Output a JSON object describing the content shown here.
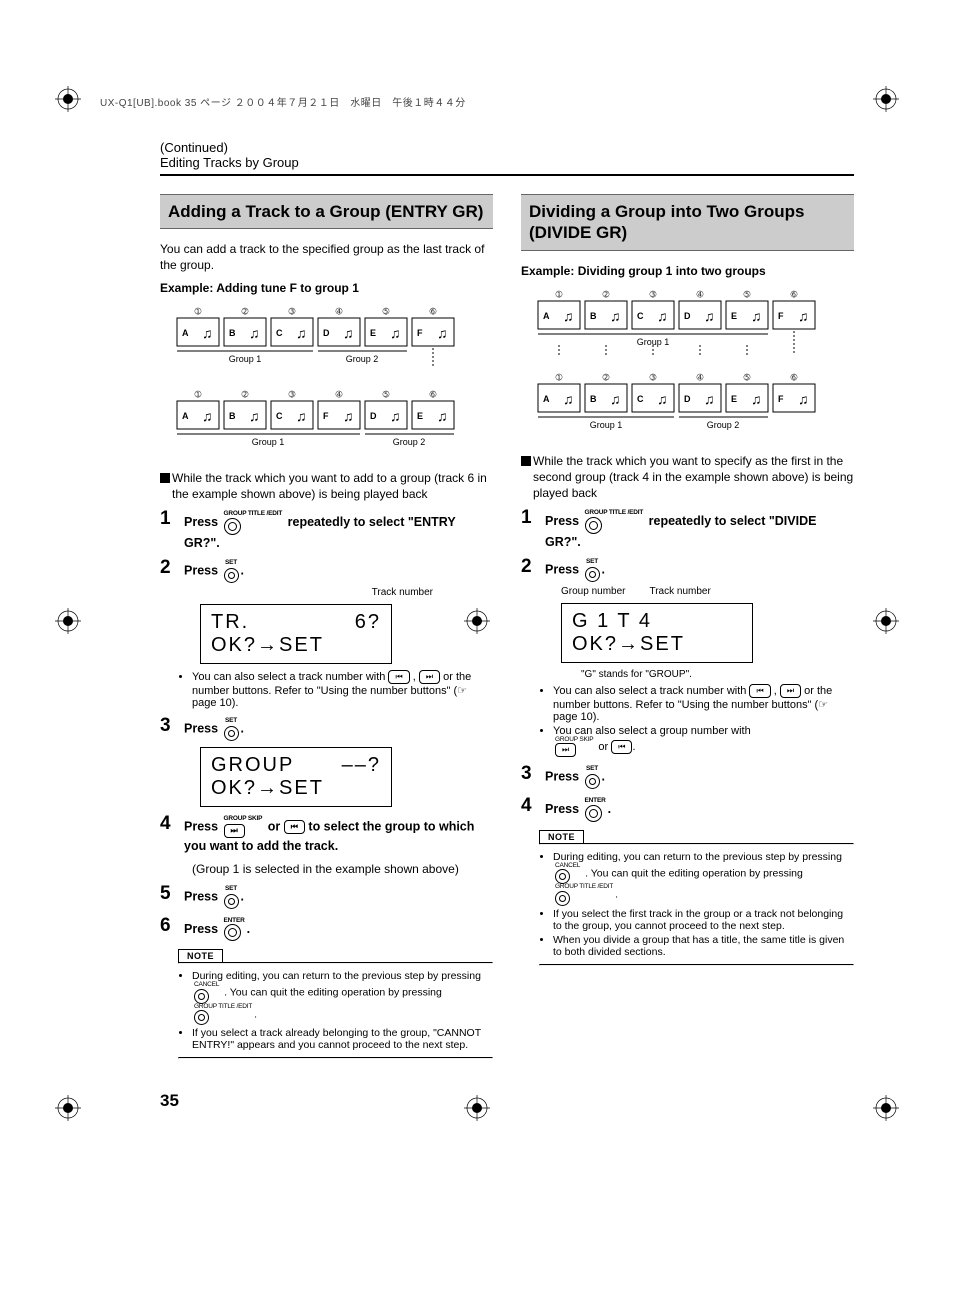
{
  "header_meta": "UX-Q1[UB].book  35 ページ  ２００４年７月２１日　水曜日　午後１時４４分",
  "continued": "(Continued)",
  "section_title": "Editing Tracks by Group",
  "page_number": "35",
  "icon_labels": {
    "group_title_edit": "GROUP TITLE /EDIT",
    "set": "SET",
    "enter": "ENTER",
    "group_skip": "GROUP SKIP",
    "cancel": "CANCEL"
  },
  "left": {
    "heading": "Adding a Track to a Group (ENTRY GR)",
    "intro": "You can add a track to the specified group as the last track of the group.",
    "example_label": "Example: Adding tune F to group 1",
    "diagram": {
      "before": {
        "numbers": [
          "➀",
          "➁",
          "➂",
          "➃",
          "➄",
          "➅"
        ],
        "letters": [
          "A",
          "B",
          "C",
          "D",
          "E",
          "F"
        ],
        "group1_label": "Group 1",
        "group2_label": "Group 2"
      },
      "after": {
        "numbers": [
          "➀",
          "➁",
          "➂",
          "➃",
          "➄",
          "➅"
        ],
        "letters": [
          "A",
          "B",
          "C",
          "F",
          "D",
          "E"
        ],
        "group1_label": "Group 1",
        "group2_label": "Group 2"
      }
    },
    "precondition": "While the track which you want to add to a group (track 6 in the example shown above) is being played back",
    "step1": "Press",
    "step1_tail": "repeatedly to select \"ENTRY GR?\".",
    "step2": "Press",
    "display1_label": "Track number",
    "display1_line1_left": "TR.",
    "display1_line1_right": "6?",
    "display1_line2": "OK?→SET",
    "bullet1": "You can also select a track number with",
    "bullet1_tail": "or the number buttons. Refer to \"Using the number buttons\" (☞ page 10).",
    "step3": "Press",
    "display2_line1_left": "GROUP",
    "display2_line1_right": "––?",
    "display2_line2": "OK?→SET",
    "step4": "Press",
    "step4_mid": "or",
    "step4_tail": "to select the group to which you want to add the track.",
    "step4_note": "(Group 1 is selected in the example shown above)",
    "step5": "Press",
    "step6": "Press",
    "note_label": "NOTE",
    "notes": [
      "During editing, you can return to the previous step by pressing      . You can quit the editing operation by pressing      .",
      "If you select a track already belonging to the group, \"CANNOT ENTRY!\" appears and you cannot proceed to the next step."
    ]
  },
  "right": {
    "heading": "Dividing a Group into Two Groups (DIVIDE GR)",
    "example_label": "Example: Dividing group 1 into two groups",
    "diagram": {
      "before": {
        "numbers": [
          "➀",
          "➁",
          "➂",
          "➃",
          "➄",
          "➅"
        ],
        "letters": [
          "A",
          "B",
          "C",
          "D",
          "E",
          "F"
        ],
        "group1_label": "Group 1"
      },
      "after": {
        "numbers": [
          "➀",
          "➁",
          "➂",
          "➃",
          "➄",
          "➅"
        ],
        "letters": [
          "A",
          "B",
          "C",
          "D",
          "E",
          "F"
        ],
        "group1_label": "Group 1",
        "group2_label": "Group 2"
      }
    },
    "precondition": "While the track which you want to specify as the first in the second group (track 4 in the example shown above) is being played back",
    "step1": "Press",
    "step1_tail": "repeatedly to select \"DIVIDE GR?\".",
    "step2": "Press",
    "display1_label_left": "Group number",
    "display1_label_right": "Track number",
    "display1_line1": "G   1  T     4",
    "display1_line2": "OK?→SET",
    "display1_caption": "\"G\" stands for \"GROUP\".",
    "bullet1": "You can also select a track number with",
    "bullet1_tail": "or the number buttons. Refer to \"Using the number buttons\" (☞ page 10).",
    "bullet2": "You can also select a group number with",
    "bullet2_mid": "or",
    "step3": "Press",
    "step4": "Press",
    "note_label": "NOTE",
    "notes": [
      "During editing, you can return to the previous step by pressing      . You can quit the editing operation by pressing      .",
      "If you select the first track in the group or a track not belonging to the group, you cannot proceed to the next step.",
      "When you divide a group that has a title, the same title is given to both divided sections."
    ]
  }
}
